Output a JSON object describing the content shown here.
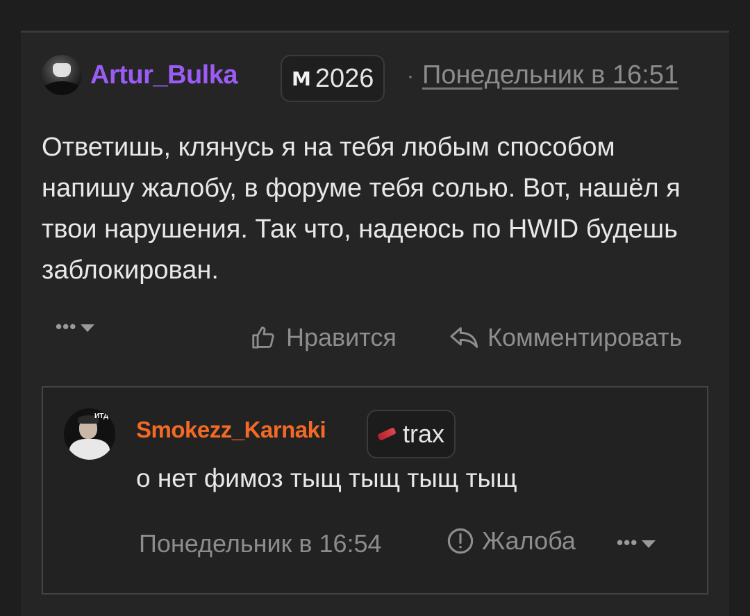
{
  "post": {
    "author": "Artur_Bulka",
    "badge_icon": "m-icon",
    "badge_text": "2026",
    "separator": "·",
    "date": "Понедельник в 16:51",
    "text": "Ответишь, клянусь я на тебя любым способом напишу жалобу, в форуме тебя солью. Вот, нашёл я твои нарушения. Так что, надеюсь по HWID будешь заблокирован.",
    "more_label": "•••",
    "like_label": "Нравится",
    "comment_label": "Комментировать"
  },
  "reply": {
    "author": "Smokezz_Karnaki",
    "avatar_tag": "ИТД",
    "badge_text": "trax",
    "text": "о нет фимоз тыщ тыщ тыщ тыщ",
    "date": "Понедельник в 16:54",
    "report_label": "Жалоба",
    "more_label": "•••"
  },
  "colors": {
    "author_purple": "#9b5cf6",
    "reply_author_orange": "#f26a25"
  }
}
